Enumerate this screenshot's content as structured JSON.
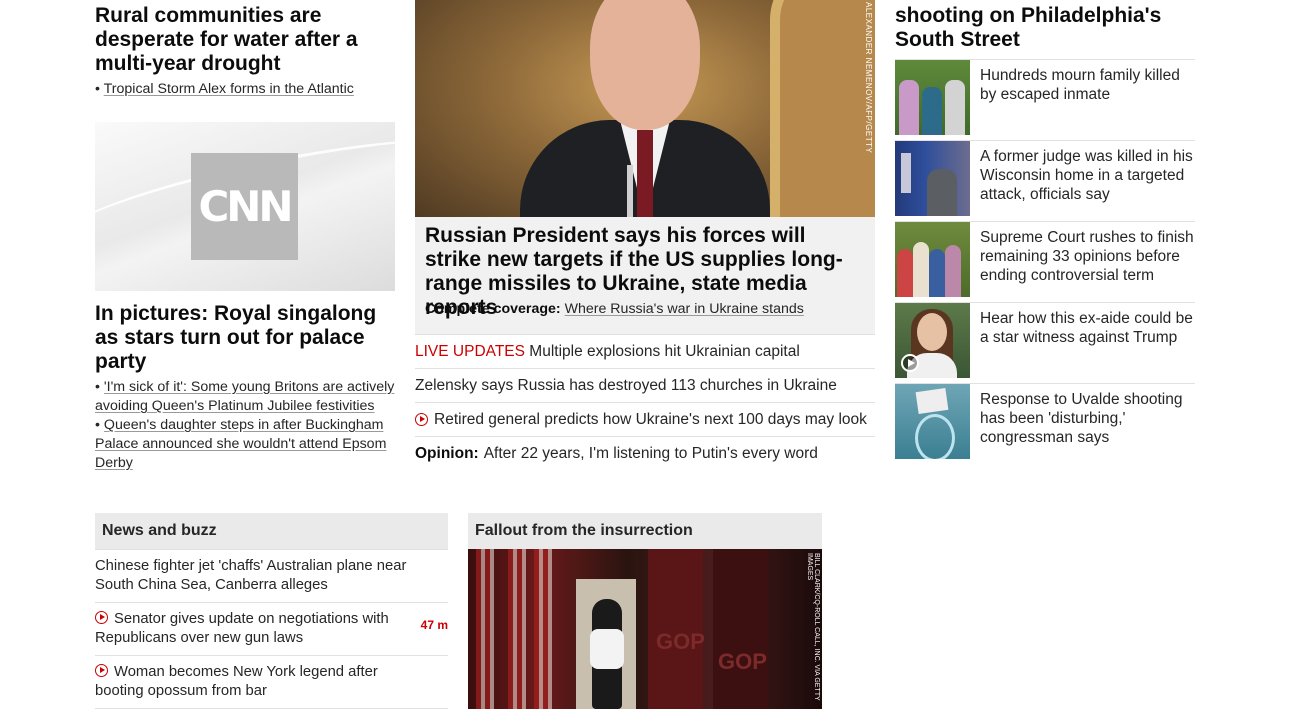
{
  "left": {
    "story1_headline": "Rural communities are desperate for water after a multi-year drought",
    "story1_bullets": [
      "Tropical Storm Alex forms in the Atlantic"
    ],
    "story2_headline": "In pictures: Royal singalong as stars turn out for palace party",
    "story2_logo": "CNN",
    "story2_bullets": [
      "'I'm sick of it': Some young Britons are actively avoiding Queen's Platinum Jubilee festivities",
      "Queen's daughter steps in after Buckingham Palace announced she wouldn't attend Epsom Derby"
    ]
  },
  "middle": {
    "hero_credit": "ALEXANDER NEMENOV/AFP/GETTY",
    "headline": "Russian President says his forces will strike new targets if the US supplies long-range missiles to Ukraine, state media reports",
    "complete_coverage_label": "Complete coverage:",
    "complete_coverage_link": "Where Russia's war in Ukraine stands",
    "rows": [
      {
        "prefix": "LIVE UPDATES",
        "text": "Multiple explosions hit Ukrainian capital",
        "icon": ""
      },
      {
        "prefix": "",
        "text": "Zelensky says Russia has destroyed 113 churches in Ukraine",
        "icon": ""
      },
      {
        "prefix": "",
        "text": "Retired general predicts how Ukraine's next 100 days may look",
        "icon": "play-icon"
      },
      {
        "prefix": "Opinion:",
        "text": "After 22 years, I'm listening to Putin's every word",
        "icon": ""
      }
    ]
  },
  "right": {
    "top_headline": "shooting on Philadelphia's South Street",
    "cards": [
      {
        "text": "Hundreds mourn family killed by escaped inmate"
      },
      {
        "text": "A former judge was killed in his Wisconsin home in a targeted attack, officials say"
      },
      {
        "text": "Supreme Court rushes to finish remaining 33 opinions before ending controversial term"
      },
      {
        "text": "Hear how this ex-aide could be a star witness against Trump"
      },
      {
        "text": "Response to Uvalde shooting has been 'disturbing,' congressman says"
      }
    ]
  },
  "news_and_buzz": {
    "title": "News and buzz",
    "items": [
      {
        "text": "Chinese fighter jet 'chaffs' Australian plane near South China Sea, Canberra alleges",
        "time": ""
      },
      {
        "text": "Senator gives update on negotiations with Republicans over new gun laws",
        "time": "47 m"
      },
      {
        "text": "Woman becomes New York legend after booting opossum from bar",
        "time": ""
      }
    ]
  },
  "fallout": {
    "title": "Fallout from the insurrection",
    "image_credit": "BILL CLARK/CQ-ROLL CALL, INC. VIA GETTY IMAGES",
    "image_text": "GOP"
  },
  "colors": {
    "accent_red": "#cc0000",
    "section_bg": "#eaeaea",
    "caption_bg": "#f1f1f1"
  }
}
